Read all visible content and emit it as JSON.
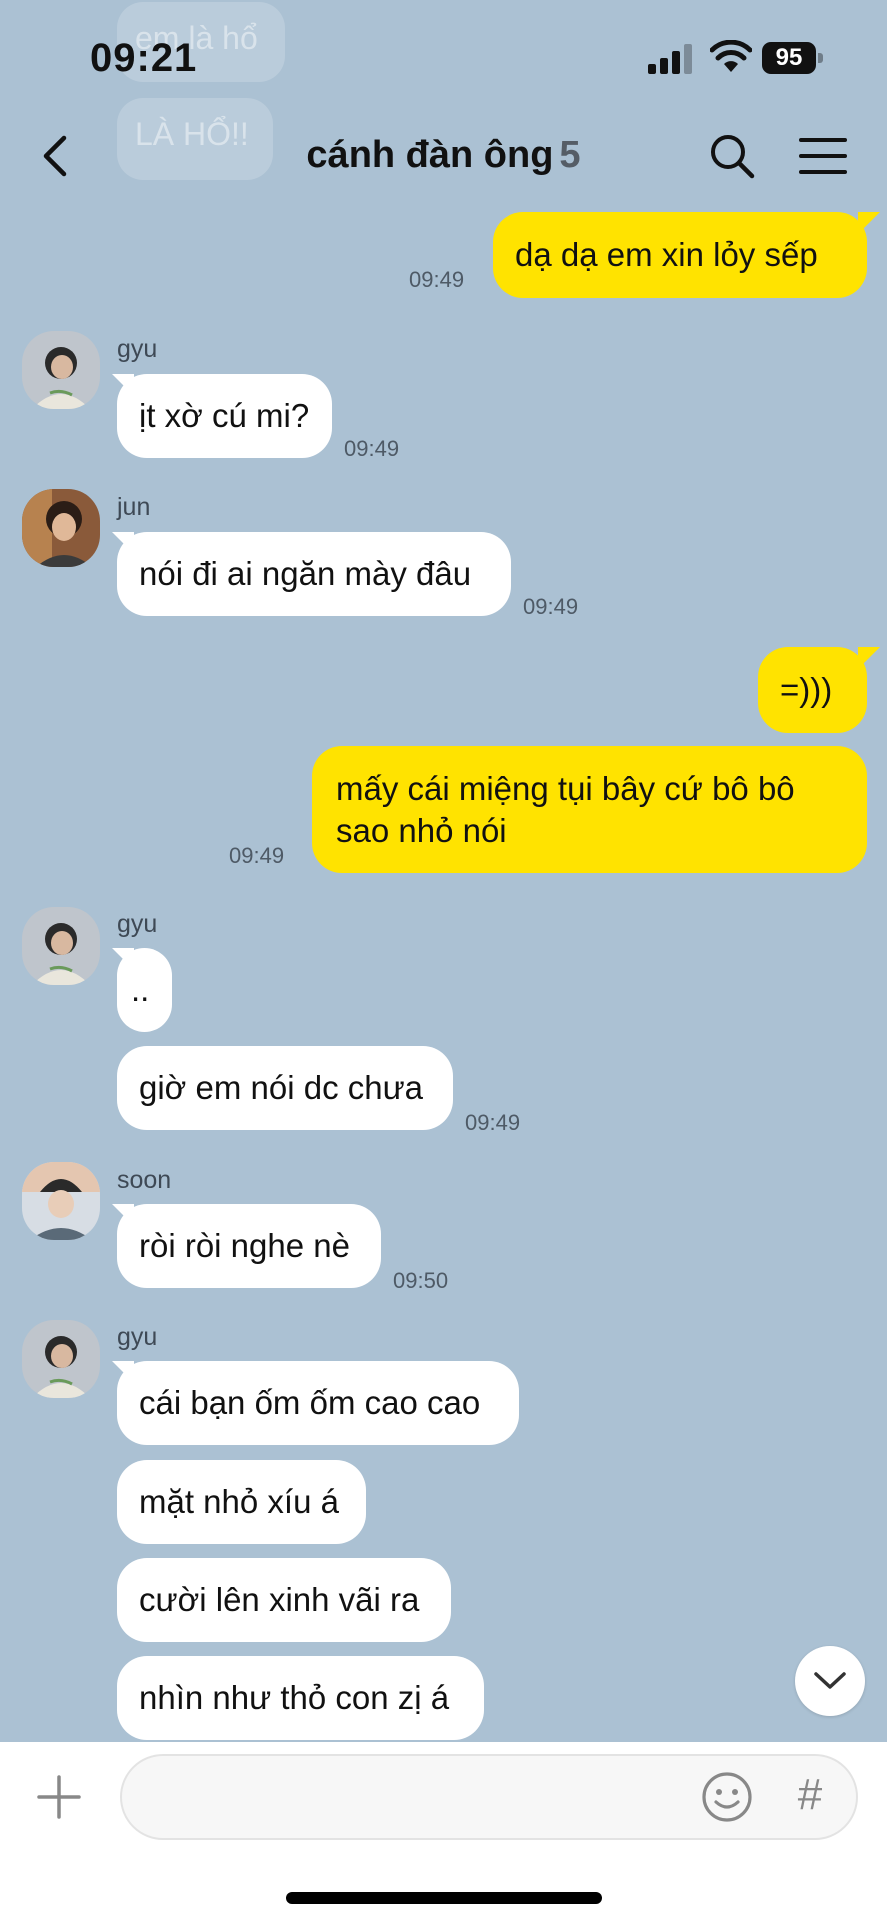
{
  "background_ghosts": [
    "em là hổ",
    "LÀ HỔ!!"
  ],
  "status_bar": {
    "time": "09:21",
    "battery": "95"
  },
  "header": {
    "title": "cánh đàn ông",
    "member_count": "5"
  },
  "messages": [
    {
      "dir": "out",
      "text": "dạ dạ em xin lỏy sếp",
      "time": "09:49"
    },
    {
      "dir": "in",
      "sender": "gyu",
      "text": "ịt xờ cú mi?",
      "time": "09:49"
    },
    {
      "dir": "in",
      "sender": "jun",
      "text": "nói đi ai ngăn mày đâu",
      "time": "09:49"
    },
    {
      "dir": "out",
      "text": "=)))",
      "time": ""
    },
    {
      "dir": "out",
      "text": "mấy cái miệng tụi bây cứ bô bô sao nhỏ nói",
      "time": "09:49"
    },
    {
      "dir": "in",
      "sender": "gyu",
      "text": "..",
      "time": ""
    },
    {
      "dir": "in",
      "sender": "",
      "text": "giờ em nói dc chưa",
      "time": "09:49"
    },
    {
      "dir": "in",
      "sender": "soon",
      "text": "ròi ròi nghe nè",
      "time": "09:50"
    },
    {
      "dir": "in",
      "sender": "gyu",
      "text": "cái bạn ốm ốm cao cao",
      "time": ""
    },
    {
      "dir": "in",
      "sender": "",
      "text": "mặt nhỏ xíu á",
      "time": ""
    },
    {
      "dir": "in",
      "sender": "",
      "text": "cười lên xinh vãi ra",
      "time": ""
    },
    {
      "dir": "in",
      "sender": "",
      "text": "nhìn như thỏ con zị á",
      "time": ""
    }
  ],
  "input": {
    "placeholder": "",
    "hash_symbol": "#"
  },
  "icons": {
    "back": "chevron-left-icon",
    "search": "search-icon",
    "menu": "hamburger-menu-icon",
    "scroll": "chevron-down-icon",
    "plus": "plus-icon",
    "emoji": "smiley-icon"
  },
  "colors": {
    "background": "#abc1d3",
    "outgoing_bubble": "#ffe300",
    "incoming_bubble": "#ffffff"
  }
}
